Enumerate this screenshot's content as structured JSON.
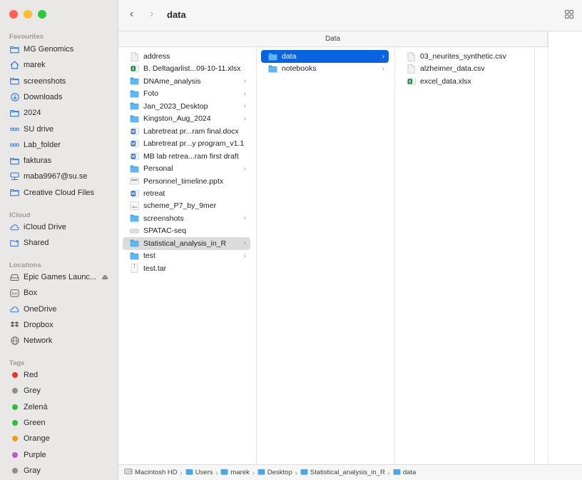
{
  "window": {
    "title": "data",
    "column_header": "Data",
    "colors": {
      "accent": "#0a63e0",
      "folder": "#4aa6e8"
    }
  },
  "sidebar": {
    "favourites_label": "Favourites",
    "favourites": [
      {
        "label": "MG Genomics",
        "icon": "folder-icon"
      },
      {
        "label": "marek",
        "icon": "home-icon"
      },
      {
        "label": "screenshots",
        "icon": "folder-icon"
      },
      {
        "label": "Downloads",
        "icon": "download-icon"
      },
      {
        "label": "2024",
        "icon": "folder-icon"
      },
      {
        "label": "SU drive",
        "icon": "network-drive-icon"
      },
      {
        "label": "Lab_folder",
        "icon": "network-drive-icon"
      },
      {
        "label": "fakturas",
        "icon": "folder-icon"
      },
      {
        "label": "maba9967@su.se",
        "icon": "shared-server-icon"
      },
      {
        "label": "Creative Cloud Files",
        "icon": "folder-icon"
      }
    ],
    "icloud_label": "iCloud",
    "icloud": [
      {
        "label": "iCloud Drive",
        "icon": "cloud-icon"
      },
      {
        "label": "Shared",
        "icon": "shared-folder-icon"
      }
    ],
    "locations_label": "Locations",
    "locations": [
      {
        "label": "Epic Games Launc...",
        "icon": "drive-icon"
      },
      {
        "label": "Box",
        "icon": "box-icon"
      },
      {
        "label": "OneDrive",
        "icon": "cloud-icon"
      },
      {
        "label": "Dropbox",
        "icon": "dropbox-icon"
      },
      {
        "label": "Network",
        "icon": "globe-icon"
      }
    ],
    "tags_label": "Tags",
    "tags": [
      {
        "label": "Red",
        "color": "#e8322f"
      },
      {
        "label": "Grey",
        "color": "#8e8e8e"
      },
      {
        "label": "Zelená",
        "color": "#2fbf3a"
      },
      {
        "label": "Green",
        "color": "#2fbf3a"
      },
      {
        "label": "Orange",
        "color": "#f59a1b"
      },
      {
        "label": "Purple",
        "color": "#b45cd6"
      },
      {
        "label": "Gray",
        "color": "#8e8e8e"
      }
    ]
  },
  "columns": [
    {
      "items": [
        {
          "label": "address",
          "icon": "document-icon",
          "folder": false
        },
        {
          "label": "B. Deltagarlist...09-10-11.xlsx",
          "icon": "excel-file-icon",
          "folder": false
        },
        {
          "label": "DNAme_analysis",
          "icon": "folder-icon",
          "folder": true
        },
        {
          "label": "Foto",
          "icon": "folder-icon",
          "folder": true
        },
        {
          "label": "Jan_2023_Desktop",
          "icon": "folder-icon",
          "folder": true
        },
        {
          "label": "Kingston_Aug_2024",
          "icon": "folder-icon",
          "folder": true
        },
        {
          "label": "Labretreat pr...ram final.docx",
          "icon": "word-file-icon",
          "folder": false
        },
        {
          "label": "Labretreat pr...y program_v1.1",
          "icon": "word-file-icon",
          "folder": false
        },
        {
          "label": "MB lab retrea...ram first draft",
          "icon": "word-file-icon",
          "folder": false
        },
        {
          "label": "Personal",
          "icon": "folder-icon",
          "folder": true
        },
        {
          "label": "Personnel_timeline.pptx",
          "icon": "presentation-file-icon",
          "folder": false
        },
        {
          "label": "retreat",
          "icon": "word-file-icon",
          "folder": false
        },
        {
          "label": "scheme_P7_by_9mer",
          "icon": "image-file-icon",
          "folder": false
        },
        {
          "label": "screenshots",
          "icon": "folder-icon",
          "folder": true
        },
        {
          "label": "SPATAC-seq",
          "icon": "disk-image-icon",
          "folder": false
        },
        {
          "label": "Statistical_analysis_in_R",
          "icon": "folder-icon",
          "folder": true,
          "selected": "inactive"
        },
        {
          "label": "test",
          "icon": "folder-icon",
          "folder": true
        },
        {
          "label": "test.tar",
          "icon": "archive-file-icon",
          "folder": false
        }
      ]
    },
    {
      "items": [
        {
          "label": "data",
          "icon": "folder-icon",
          "folder": true,
          "selected": "active"
        },
        {
          "label": "notebooks",
          "icon": "folder-icon",
          "folder": true
        }
      ]
    },
    {
      "items": [
        {
          "label": "03_neurites_synthetic.csv",
          "icon": "document-icon",
          "folder": false
        },
        {
          "label": "alzheimer_data.csv",
          "icon": "document-icon",
          "folder": false
        },
        {
          "label": "excel_data.xlsx",
          "icon": "excel-file-icon",
          "folder": false
        }
      ]
    }
  ],
  "path": [
    {
      "label": "Macintosh HD",
      "icon": "hard-drive-icon"
    },
    {
      "label": "Users",
      "icon": "folder-icon"
    },
    {
      "label": "marek",
      "icon": "folder-icon"
    },
    {
      "label": "Desktop",
      "icon": "folder-icon"
    },
    {
      "label": "Statistical_analysis_in_R",
      "icon": "folder-icon"
    },
    {
      "label": "data",
      "icon": "folder-icon"
    }
  ]
}
